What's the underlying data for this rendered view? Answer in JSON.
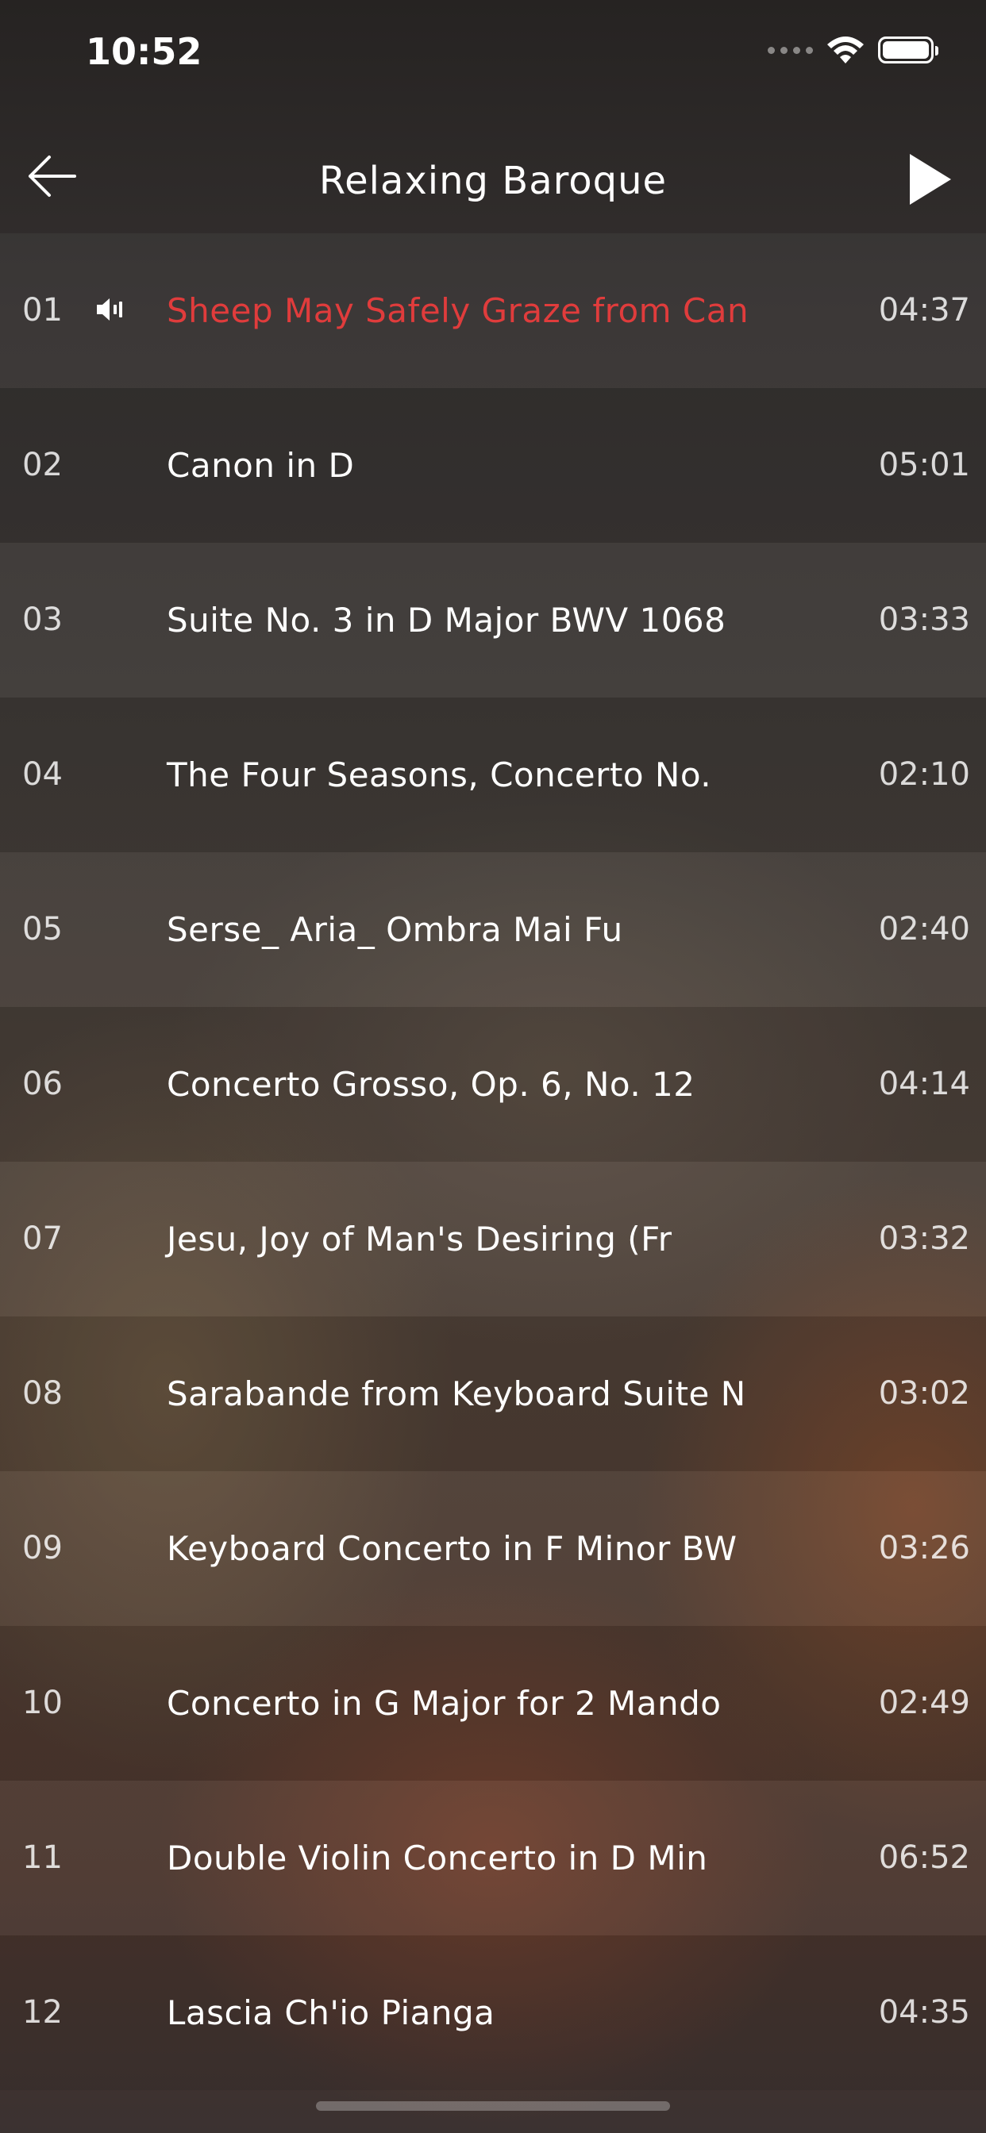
{
  "status_bar": {
    "time": "10:52",
    "icons": [
      "signal-dots-icon",
      "wifi-icon",
      "battery-icon"
    ]
  },
  "nav": {
    "title": "Relaxing Baroque",
    "back_icon": "arrow-left-icon",
    "play_icon": "play-icon"
  },
  "colors": {
    "active_track": "#e03c3c",
    "text": "#ffffff"
  },
  "tracks": [
    {
      "number": "01",
      "title": "Sheep May Safely Graze from Can",
      "duration": "04:37",
      "playing": true
    },
    {
      "number": "02",
      "title": "Canon in D",
      "duration": "05:01"
    },
    {
      "number": "03",
      "title": "Suite No. 3 in D Major BWV 1068",
      "duration": "03:33"
    },
    {
      "number": "04",
      "title": "The Four Seasons, Concerto No.",
      "duration": "02:10"
    },
    {
      "number": "05",
      "title": "Serse_ Aria_ Ombra Mai Fu",
      "duration": "02:40"
    },
    {
      "number": "06",
      "title": "Concerto Grosso, Op. 6, No. 12",
      "duration": "04:14"
    },
    {
      "number": "07",
      "title": "Jesu, Joy of Man's Desiring (Fr",
      "duration": "03:32"
    },
    {
      "number": "08",
      "title": "Sarabande from Keyboard Suite N",
      "duration": "03:02"
    },
    {
      "number": "09",
      "title": "Keyboard Concerto in F Minor BW",
      "duration": "03:26"
    },
    {
      "number": "10",
      "title": "Concerto in G Major for 2 Mando",
      "duration": "02:49"
    },
    {
      "number": "11",
      "title": "Double Violin Concerto in D Min",
      "duration": "06:52"
    },
    {
      "number": "12",
      "title": "Lascia Ch'io Pianga",
      "duration": "04:35"
    }
  ]
}
